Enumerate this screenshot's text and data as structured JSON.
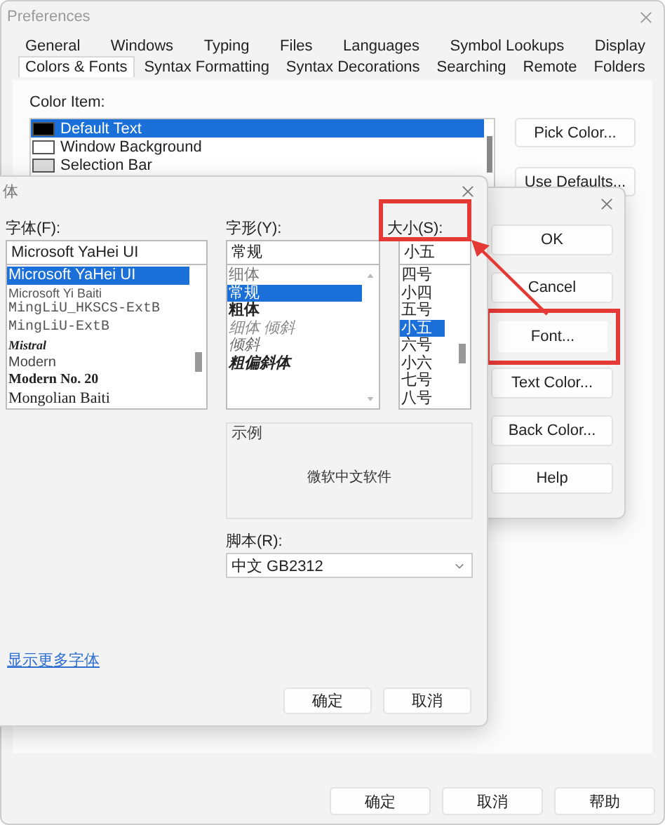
{
  "preferences": {
    "title": "Preferences",
    "tab_rows": [
      [
        {
          "label": "General",
          "selected": false
        },
        {
          "label": "Windows",
          "selected": false
        },
        {
          "label": "Typing",
          "selected": false
        },
        {
          "label": "Files",
          "selected": false
        },
        {
          "label": "Languages",
          "selected": false
        },
        {
          "label": "Symbol Lookups",
          "selected": false
        },
        {
          "label": "Display",
          "selected": false
        }
      ],
      [
        {
          "label": "Colors & Fonts",
          "selected": true
        },
        {
          "label": "Syntax Formatting",
          "selected": false
        },
        {
          "label": "Syntax Decorations",
          "selected": false
        },
        {
          "label": "Searching",
          "selected": false
        },
        {
          "label": "Remote",
          "selected": false
        },
        {
          "label": "Folders",
          "selected": false
        }
      ]
    ],
    "color_item_label": "Color Item:",
    "color_items": [
      {
        "label": "Default Text",
        "color": "#000000",
        "selected": true
      },
      {
        "label": "Window Background",
        "color": "#ffffff",
        "selected": false
      },
      {
        "label": "Selection Bar",
        "color": "#dcdcdc",
        "selected": false
      }
    ],
    "side_buttons": [
      "Pick Color...",
      "Use Defaults..."
    ],
    "buttons": [
      "确定",
      "取消",
      "帮助"
    ]
  },
  "color_dialog": {
    "buttons": [
      {
        "label": "OK",
        "annotated": false
      },
      {
        "label": "Cancel",
        "annotated": false
      },
      {
        "label": "Font...",
        "annotated": true
      },
      {
        "label": "Text Color...",
        "annotated": false
      },
      {
        "label": "Back Color...",
        "annotated": false
      },
      {
        "label": "Help",
        "annotated": false
      }
    ]
  },
  "font_dialog": {
    "title": "体",
    "font": {
      "label": "字体(F):",
      "value": "Microsoft YaHei UI",
      "items": [
        {
          "label": "Microsoft YaHei UI",
          "kind": "ui",
          "selected": true
        },
        {
          "label": "Microsoft Yi Baiti",
          "kind": "small",
          "selected": false
        },
        {
          "label": "MingLiU_HKSCS-ExtB",
          "kind": "mono",
          "selected": false
        },
        {
          "label": "MingLiU-ExtB",
          "kind": "mono",
          "selected": false
        },
        {
          "label": "Mistral",
          "kind": "script",
          "selected": false
        },
        {
          "label": "Modern",
          "kind": "plain",
          "selected": false
        },
        {
          "label": "Modern No. 20",
          "kind": "serif-bold",
          "selected": false
        },
        {
          "label": "Mongolian Baiti",
          "kind": "serif",
          "selected": false
        }
      ]
    },
    "style": {
      "label": "字形(Y):",
      "value": "常规",
      "items": [
        {
          "label": "细体",
          "kind": "light",
          "selected": false
        },
        {
          "label": "常规",
          "kind": "regular",
          "selected": true
        },
        {
          "label": "粗体",
          "kind": "bold",
          "selected": false
        },
        {
          "label": "细体 倾斜",
          "kind": "light-italic",
          "selected": false
        },
        {
          "label": "倾斜",
          "kind": "italic",
          "selected": false
        },
        {
          "label": "粗偏斜体",
          "kind": "bold-italic",
          "selected": false
        }
      ]
    },
    "size": {
      "label": "大小(S):",
      "annotated": true,
      "value": "小五",
      "items": [
        {
          "label": "四号",
          "selected": false
        },
        {
          "label": "小四",
          "selected": false
        },
        {
          "label": "五号",
          "selected": false
        },
        {
          "label": "小五",
          "selected": true
        },
        {
          "label": "六号",
          "selected": false
        },
        {
          "label": "小六",
          "selected": false
        },
        {
          "label": "七号",
          "selected": false
        },
        {
          "label": "八号",
          "selected": false
        }
      ]
    },
    "sample_label": "示例",
    "sample_text": "微软中文软件",
    "script_label": "脚本(R):",
    "script_value": "中文 GB2312",
    "more_fonts_link": "显示更多字体",
    "buttons": [
      "确定",
      "取消"
    ]
  }
}
